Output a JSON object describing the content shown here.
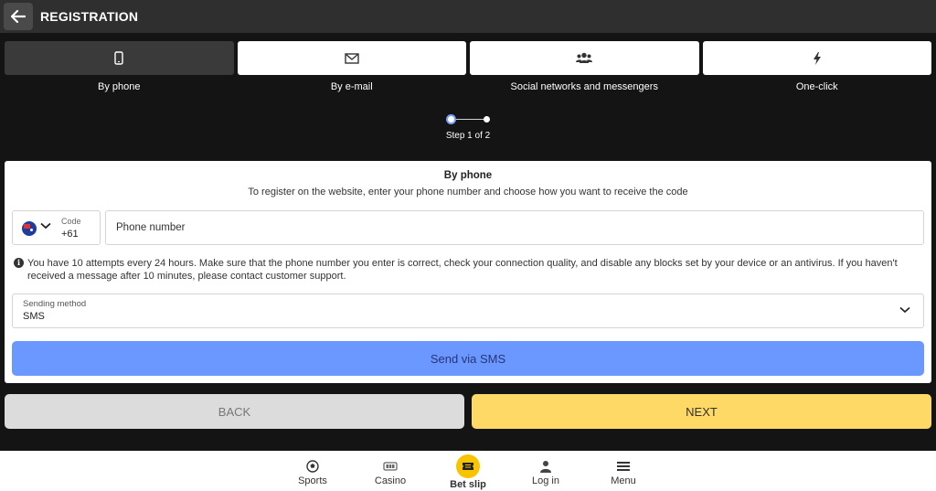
{
  "header": {
    "title": "REGISTRATION"
  },
  "tabs": [
    {
      "label": "By phone",
      "icon": "phone-icon",
      "active": true
    },
    {
      "label": "By e-mail",
      "icon": "envelope-icon",
      "active": false
    },
    {
      "label": "Social networks and messengers",
      "icon": "users-icon",
      "active": false
    },
    {
      "label": "One-click",
      "icon": "lightning-icon",
      "active": false
    }
  ],
  "stepper": {
    "label": "Step 1 of 2",
    "current": 1,
    "total": 2
  },
  "form": {
    "title": "By phone",
    "subtitle": "To register on the website, enter your phone number and choose how you want to receive the code",
    "code_label": "Code",
    "code_value": "+61",
    "phone_placeholder": "Phone number",
    "info_text": "You have 10 attempts every 24 hours. Make sure that the phone number you enter is correct, check your connection quality, and disable any blocks set by your device or an antivirus. If you haven't received a message after 10 minutes, please contact customer support.",
    "sending_method_label": "Sending method",
    "sending_method_value": "SMS",
    "send_button": "Send via SMS"
  },
  "actions": {
    "back": "BACK",
    "next": "NEXT"
  },
  "bottom_nav": [
    {
      "label": "Sports",
      "icon": "soccer-ball-icon"
    },
    {
      "label": "Casino",
      "icon": "slot-machine-icon"
    },
    {
      "label": "Bet slip",
      "icon": "ticket-icon"
    },
    {
      "label": "Log in",
      "icon": "user-icon"
    },
    {
      "label": "Menu",
      "icon": "hamburger-icon"
    }
  ],
  "colors": {
    "header_bg": "#2f2f2f",
    "page_bg": "#141414",
    "send_button": "#6b98ff",
    "next_button": "#ffd965",
    "back_button": "#dcdcdc",
    "betslip_accent": "#f8c400"
  }
}
